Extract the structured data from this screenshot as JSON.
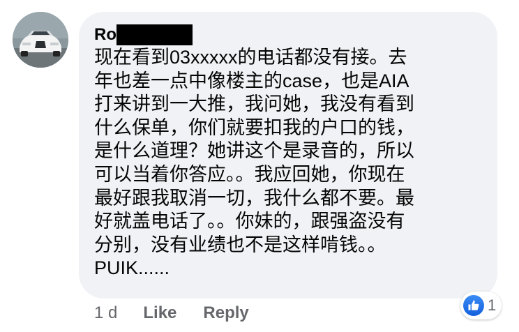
{
  "comment": {
    "author_visible": "Ro",
    "body_lines": [
      "现在看到03xxxxx的电话都没有接。去",
      "年也差一点中像楼主的case，也是AIA",
      "打来讲到一大推，我问她，我没有看到",
      "什么保单，你们就要扣我的户口的钱，",
      "是什么道理？她讲这个是录音的，所以",
      "可以当着你答应。。我应回她，你现在",
      "最好跟我取消一切，我什么都不要。最",
      "好就盖电话了。。你妹的，跟强盗没有",
      "分别，没有业绩也不是这样啃钱。。",
      "PUIK......"
    ]
  },
  "actions": {
    "timestamp": "1 d",
    "like_label": "Like",
    "reply_label": "Reply"
  },
  "reactions": {
    "icon": "thumbs-up-icon",
    "count": "1"
  },
  "colors": {
    "bubble_bg": "#f0f2f5",
    "text": "#050505",
    "muted": "#65676b",
    "like_blue": "#1877f2"
  }
}
